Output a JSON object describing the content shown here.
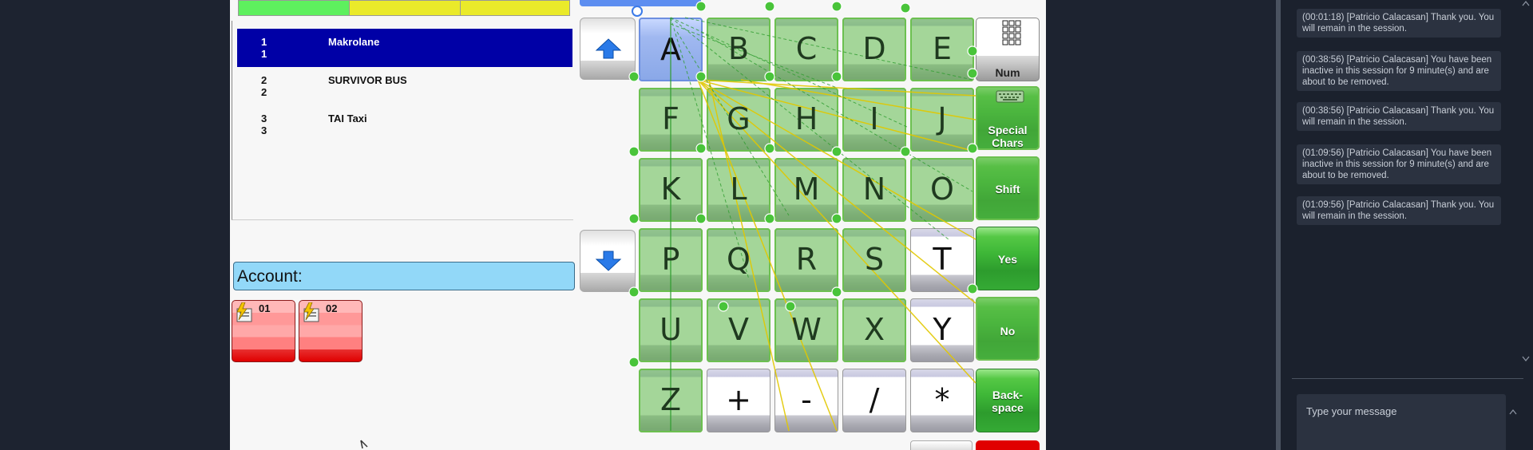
{
  "order_list": [
    {
      "num1": "1",
      "num2": "1",
      "name": "Makrolane",
      "selected": true
    },
    {
      "num1": "2",
      "num2": "2",
      "name": "SURVIVOR BUS",
      "selected": false
    },
    {
      "num1": "3",
      "num2": "3",
      "name": "TAI Taxi",
      "selected": false
    }
  ],
  "account": {
    "label": "Account:"
  },
  "tiles": [
    {
      "label": "01"
    },
    {
      "label": "02"
    }
  ],
  "keyboard": {
    "rows": [
      [
        "A",
        "B",
        "C",
        "D",
        "E"
      ],
      [
        "F",
        "G",
        "H",
        "I",
        "J"
      ],
      [
        "K",
        "L",
        "M",
        "N",
        "O"
      ],
      [
        "P",
        "Q",
        "R",
        "S",
        "T"
      ],
      [
        "U",
        "V",
        "W",
        "X",
        "Y"
      ],
      [
        "Z",
        "+",
        "-",
        "/",
        "*"
      ]
    ],
    "side": {
      "num": "Num",
      "special_line1": "Special",
      "special_line2": "Chars",
      "shift": "Shift",
      "yes": "Yes",
      "no": "No",
      "backspace_line1": "Back-",
      "backspace_line2": "space"
    }
  },
  "chat": {
    "messages": [
      "(00:01:18) [Patricio Calacasan] Thank you. You will remain in the session.",
      "(00:38:56) [Patricio Calacasan] You have been inactive in this session for 9 minute(s) and are about to be removed.",
      "(00:38:56) [Patricio Calacasan] Thank you. You will remain in the session.",
      "(01:09:56) [Patricio Calacasan] You have been inactive in this session for 9 minute(s) and are about to be removed.",
      "(01:09:56) [Patricio Calacasan] Thank you. You will remain in the session."
    ],
    "input_placeholder": "Type your message"
  },
  "colors": {
    "selected_row": "#0000a6",
    "account_bar": "#92d8f8",
    "green_key": "#3fb838",
    "highlight_overlay": "#5ab446",
    "chat_bg": "#1b212d"
  }
}
